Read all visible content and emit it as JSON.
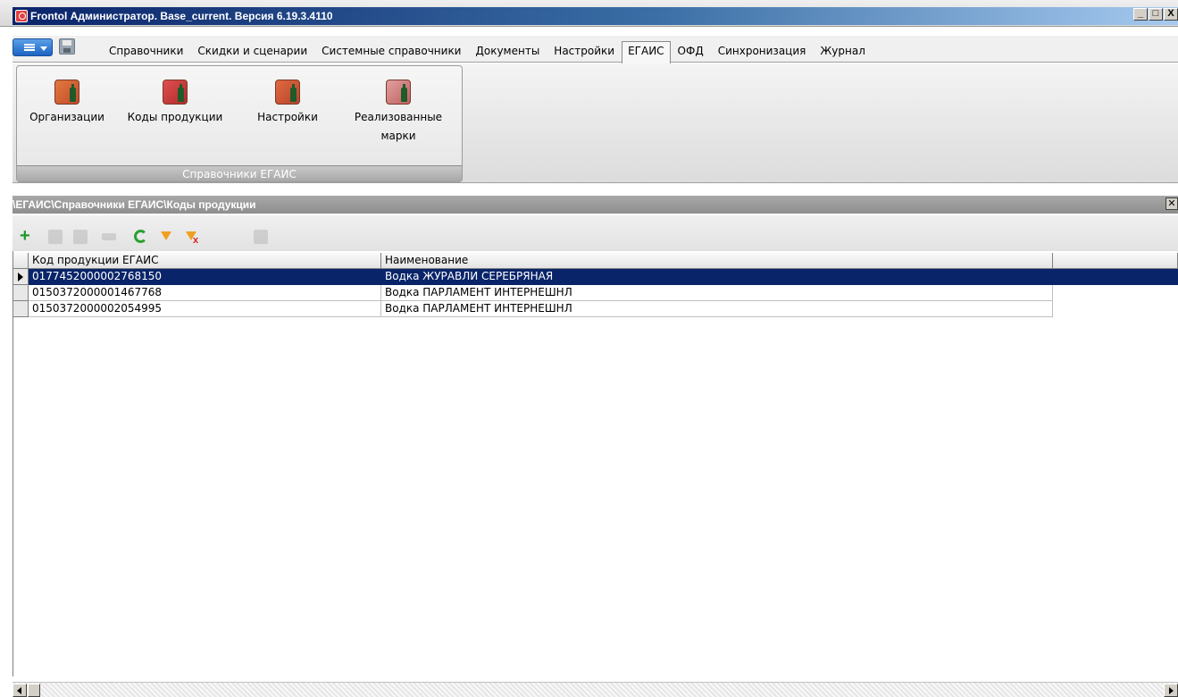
{
  "window": {
    "title": "Frontol Администратор. Base_current. Версия 6.19.3.4110",
    "buttons": {
      "minimize": "_",
      "maximize": "□",
      "close": "X"
    }
  },
  "menu": {
    "tabs": [
      {
        "label": "Справочники"
      },
      {
        "label": "Скидки и сценарии"
      },
      {
        "label": "Системные справочники"
      },
      {
        "label": "Документы"
      },
      {
        "label": "Настройки"
      },
      {
        "label": "ЕГАИС"
      },
      {
        "label": "ОФД"
      },
      {
        "label": "Синхронизация"
      },
      {
        "label": "Журнал"
      }
    ],
    "active_tab": "ЕГАИС"
  },
  "ribbon": {
    "group_label": "Справочники ЕГАИС",
    "buttons": [
      {
        "label": "Организации",
        "icon": "organizations-icon"
      },
      {
        "label": "Коды продукции",
        "icon": "product-codes-icon"
      },
      {
        "label": "Настройки",
        "icon": "settings-icon"
      },
      {
        "label_line1": "Реализованные",
        "label_line2": "марки",
        "icon": "sold-marks-icon"
      }
    ]
  },
  "path": "\\ЕГАИС\\Справочники ЕГАИС\\Коды продукции",
  "toolbar": {
    "icons": [
      "add-icon",
      "edit-icon",
      "copy-icon",
      "move-icon",
      "refresh-icon",
      "filter-icon",
      "clear-filter-icon",
      "delete-icon"
    ]
  },
  "grid": {
    "columns": [
      "Код продукции ЕГАИС",
      "Наименование"
    ],
    "rows": [
      {
        "code": "0177452000002768150",
        "name": "Водка ЖУРАВЛИ СЕРЕБРЯНАЯ",
        "selected": true
      },
      {
        "code": "0150372000001467768",
        "name": "Водка ПАРЛАМЕНТ ИНТЕРНЕШНЛ",
        "selected": false
      },
      {
        "code": "0150372000002054995",
        "name": "Водка ПАРЛАМЕНТ ИНТЕРНЕШНЛ",
        "selected": false
      }
    ]
  },
  "colors": {
    "selection": "#0a246a",
    "titlebar": "#0a246a",
    "add": "#1d9a2a",
    "filter": "#f0a020"
  }
}
